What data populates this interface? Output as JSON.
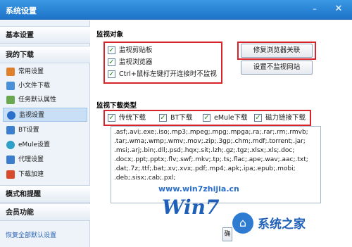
{
  "window": {
    "title": "系统设置"
  },
  "sidebar": {
    "header_basic": "基本设置",
    "header_download": "我的下载",
    "items": [
      {
        "label": "常用设置",
        "icon": "home-icon",
        "color": "#e0802a"
      },
      {
        "label": "小文件下载",
        "icon": "file-icon",
        "color": "#4a90d9"
      },
      {
        "label": "任务默认属性",
        "icon": "task-icon",
        "color": "#6aa84f"
      },
      {
        "label": "监视设置",
        "icon": "monitor-icon",
        "color": "#2a6fc9",
        "active": true
      },
      {
        "label": "BT设置",
        "icon": "bt-icon",
        "color": "#3d7fcf"
      },
      {
        "label": "eMule设置",
        "icon": "emule-icon",
        "color": "#2fa0c7"
      },
      {
        "label": "代理设置",
        "icon": "proxy-icon",
        "color": "#3b7ccc"
      },
      {
        "label": "下载加速",
        "icon": "accelerate-icon",
        "color": "#d84a2a"
      }
    ],
    "header_mode": "模式和提醒",
    "header_member": "会员功能",
    "restore_link": "恢复全部默认设置"
  },
  "monitor_target": {
    "title": "监视对象",
    "options": [
      {
        "label": "监视剪贴板",
        "checked": true
      },
      {
        "label": "监视浏览器",
        "checked": true
      },
      {
        "label": "Ctrl+鼠标左键打开连接时不监视",
        "checked": true
      }
    ],
    "repair_button": "修复浏览器关联",
    "no_monitor_button": "设置不监视网站"
  },
  "monitor_types": {
    "title": "监视下载类型",
    "options": [
      {
        "label": "传统下载",
        "checked": true
      },
      {
        "label": "BT下载",
        "checked": true
      },
      {
        "label": "eMule下载",
        "checked": true
      },
      {
        "label": "磁力链接下载",
        "checked": true
      }
    ],
    "extensions_lines": [
      ".asf;.avi;.exe;.iso;.mp3;.mpeg;.mpg;.mpga;.ra;.rar;.rm;.rmvb;",
      ".tar;.wma;.wmp;.wmv;.mov;.zip;.3gp;.chm;.mdf;.torrent;.jar;",
      ".msi;.arj;.bin;.dll;.psd;.hqx;.sit;.lzh;.gz;.tgz;.xlsx;.xls;.doc;",
      ".docx;.ppt;.pptx;.flv;.swf;.mkv;.tp;.ts;.flac;.ape;.wav;.aac;.txt;",
      ".dat;.7z;.ttf;.bat;.xv;.xvx;.pdf;.mp4;.apk;.ipa;.epub;.mobi;",
      ".deb;.sisx;.cab;.pxl;"
    ]
  },
  "watermark": {
    "url": "www.win7zhijia.cn",
    "logo_text": "Win7",
    "brand": "系统之家"
  },
  "bottom_button": "确",
  "colors": {
    "titlebar": "#2a86d8",
    "highlight": "#d8232a",
    "accent": "#2a6fc9"
  }
}
